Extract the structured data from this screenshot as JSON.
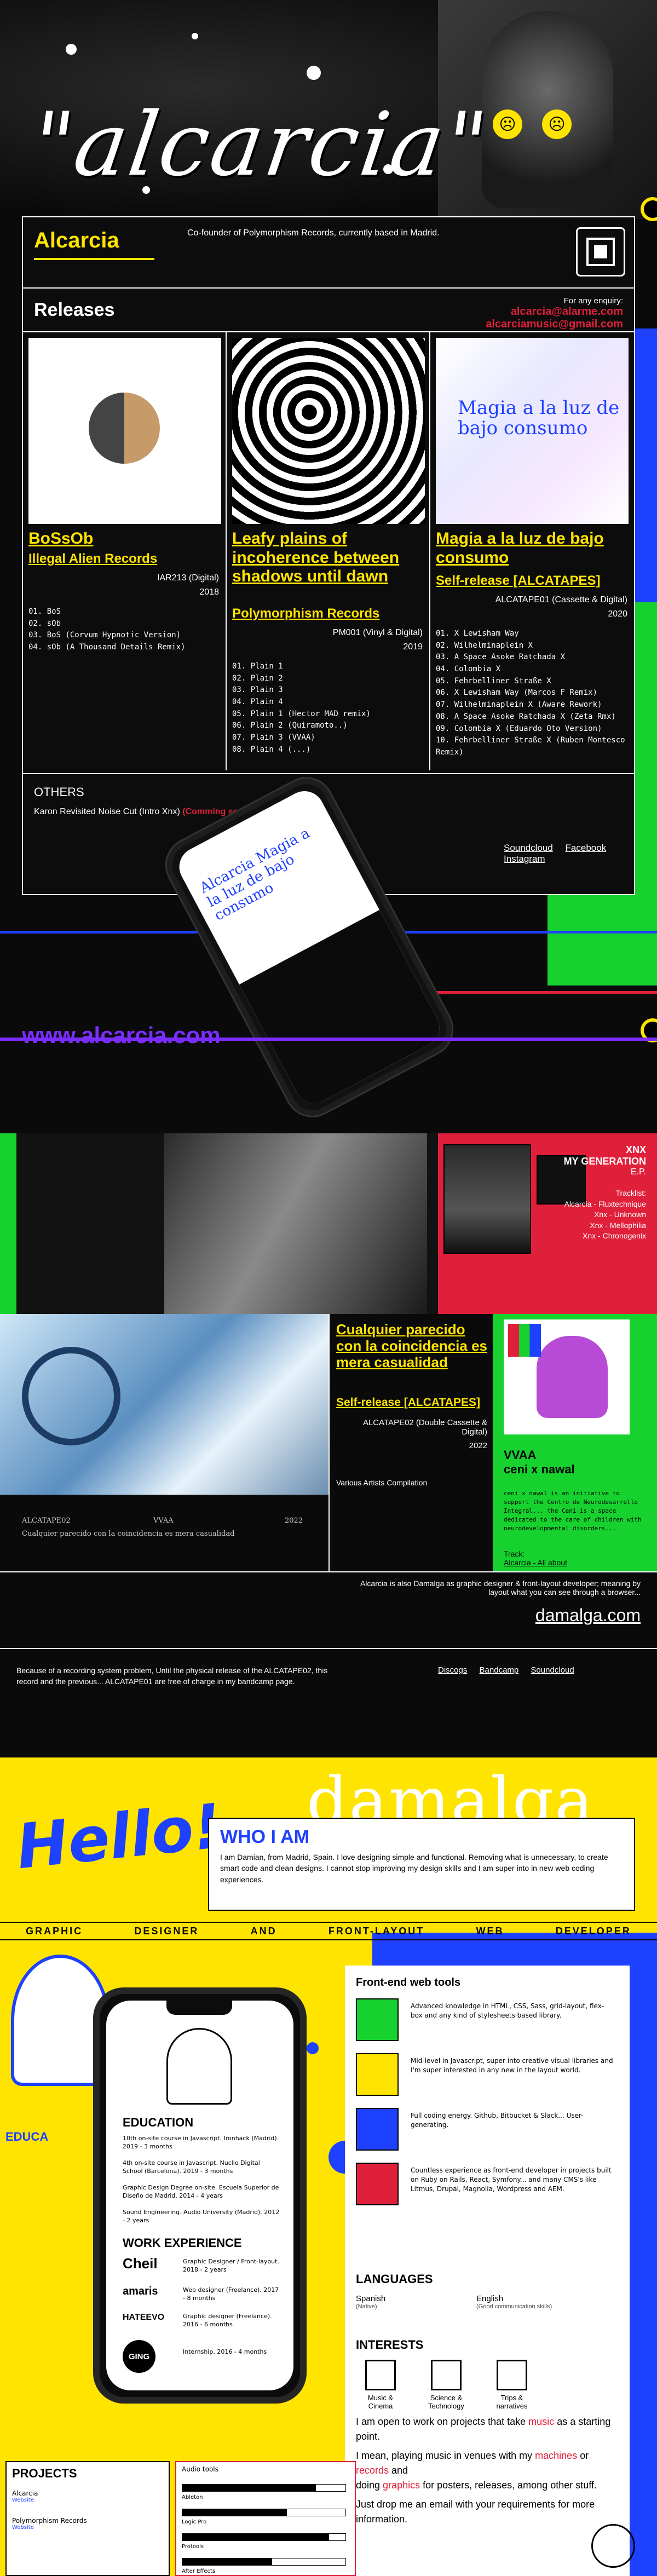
{
  "hero": {
    "logo": "\"alcarcia\"",
    "smiley_glyph": "☹"
  },
  "panel": {
    "brand": "Alcarcia",
    "intro": "Co-founder of Polymorphism Records, currently based in Madrid.",
    "releases_title": "Releases",
    "enquiry_label": "For any enquiry:",
    "enquiry_email_1": "alcarcia@alarme.com",
    "enquiry_email_2": "alcarciamusic@gmail.com",
    "releases": [
      {
        "title": "BoSsOb",
        "subtitle": "Illegal Alien Records",
        "catalog": "IAR213 (Digital)",
        "year": "2018",
        "tracks": [
          "01. BoS",
          "02. sOb",
          "03. BoS (Corvum Hypnotic Version)",
          "04. sOb (A Thousand Details Remix)"
        ]
      },
      {
        "title": "Leafy plains of incoherence between shadows until dawn",
        "subtitle": "Polymorphism Records",
        "catalog": "PM001 (Vinyl & Digital)",
        "year": "2019",
        "tracks": [
          "01. Plain 1",
          "02. Plain 2",
          "03. Plain 3",
          "04. Plain 4",
          "05. Plain 1 (Hector MAD remix)",
          "06. Plain 2 (Quiramoto..)",
          "07. Plain 3 (VVAA)",
          "08. Plain 4 (...)"
        ]
      },
      {
        "title": "Magia a la luz de bajo consumo",
        "subtitle": "Self-release [ALCATAPES]",
        "catalog": "ALCATAPE01 (Cassette & Digital)",
        "year": "2020",
        "tracks": [
          "01. X Lewisham Way",
          "02. Wilhelminaplein X",
          "03. A Space Asoke Ratchada X",
          "04. Colombia X",
          "05. Fehrbelliner Straße X",
          "06. X Lewisham Way (Marcos F Remix)",
          "07. Wilhelminaplein X (Aware Rework)",
          "08. A Space Asoke Ratchada X (Zeta Rmx)",
          "09. Colombia X (Eduardo Oto Version)",
          "10. Fehrbelliner Straße X (Ruben Montesco Remix)"
        ]
      }
    ],
    "others_title": "OTHERS",
    "others_item": "Karon Revisited Noise Cut (Intro Xnx)",
    "others_soon": "(Comming soon)",
    "social": [
      "Soundcloud",
      "Facebook",
      "Instagram"
    ]
  },
  "phone1": {
    "cover_title": "Alcarcia Magia a la luz de bajo consumo"
  },
  "url": "www.alcarcia.com",
  "collage": {
    "mygen_title": "XNX",
    "mygen_sub": "MY GENERATION",
    "mygen_ep": "E.P.",
    "mygen_tracklist": "Tracklist:",
    "mygen_tracks": [
      "Alcarcia - Fluxtechnique",
      "Xnx - Unknown",
      "Xnx - Mellophilia",
      "Xnx - Chronogenix"
    ],
    "cual_title": "Cualquier parecido con la coincidencia es mera casualidad",
    "cual_label": "Self-release [ALCATAPES]",
    "cual_catalog": "ALCATAPE02 (Double Cassette & Digital)",
    "cual_year": "2022",
    "cual_comp": "Various Artists Compilation",
    "cual_cover_caption": "Cualquier parecido con la coincidencia es mera casualidad",
    "cual_cover_small_1": "ALCATAPE02",
    "cual_cover_small_2": "VVAA",
    "cual_cover_small_3": "2022",
    "ceni_title": "VVAA",
    "ceni_sub": "ceni x nawal",
    "ceni_desc": "ceni x nawal is an initiative to support the Centro de Neurodesarrollo Integral... the Ceni is a space dedicated to the care of children with neurodevelopmental disorders...",
    "ceni_track_label": "Track:",
    "ceni_track": "Alcarcia - All about",
    "damalga_note": "Alcarcia is also Damalga as graphic designer & front-layout developer; meaning by layout what you can see through a browser...",
    "damalga_link": "damalga.com"
  },
  "note": {
    "text": "Because of a recording system problem, Until the physical release of the ALCATAPE02, this record and the previous... ALCATAPE01 are free of charge in my bandcamp page.",
    "links": [
      "Discogs",
      "Bandcamp",
      "Soundcloud"
    ]
  },
  "damalga": {
    "word": "damalga",
    "hello": "Hello!",
    "whoami": "WHO I AM",
    "whoami_text": "I am Damian, from Madrid, Spain. I love designing simple and functional. Removing what is unnecessary, to create smart code and clean designs. I cannot stop improving my design skills and I am super into in new web coding experiences.",
    "roles": [
      "GRAPHIC",
      "DESIGNER",
      "AND",
      "FRONT-LAYOUT",
      "WEB",
      "DEVELOPER"
    ],
    "education_tag": "EDUCA",
    "phone": {
      "education": "EDUCATION",
      "edu_items": [
        "10th on-site course in Javascript. Ironhack (Madrid). 2019 - 3 months",
        "4th on-site course in Javascript. Nuclio Digital School (Barcelona). 2019 - 3 months",
        "Graphic Design Degree on-site. Escuela Superior de Diseño de Madrid. 2014 - 4 years",
        "Sound Engineering. Audio University (Madrid). 2012 - 2 years"
      ],
      "work": "WORK EXPERIENCE",
      "work_items": [
        {
          "company": "Cheil",
          "role": "Graphic Designer / Front-layout. 2018 - 2 years"
        },
        {
          "company": "amaris",
          "role": "Web designer (Freelance). 2017 - 8 months"
        },
        {
          "company": "HATEEVO",
          "role": "Graphic designer (Freelance). 2016 - 6 months"
        },
        {
          "company": "GING",
          "role": "Internship. 2016 - 4 months"
        }
      ]
    },
    "frontend_title": "Front-end web tools",
    "skills": [
      "Advanced knowledge in HTML, CSS, Sass, grid-layout, flex-box and any kind of stylesheets based library.",
      "Mid-level in Javascript, super into creative visual libraries and I'm super interested in any new in the layout world.",
      "Full coding energy. Github, Bitbucket & Slack... User-generating.",
      "Countless experience as front-end developer in projects built on Ruby on Rails, React, Symfony... and many CMS's like Litmus, Drupal, Magnolia, Wordpress and AEM."
    ],
    "languages_title": "LANGUAGES",
    "languages": [
      {
        "name": "Spanish",
        "level": "(Native)"
      },
      {
        "name": "English",
        "level": "(Good communication skills)"
      }
    ],
    "interests_title": "INTERESTS",
    "interests": [
      "Music & Cinema",
      "Science & Technology",
      "Trips & narratives"
    ],
    "music_1": "I am open to work on projects that take ",
    "music_1_hl": "music",
    "music_1_end": " as a starting point.",
    "music_2": "I mean, playing music in venues with my ",
    "music_2_hl1": "machines",
    "music_2_mid": " or ",
    "music_2_hl2": "records",
    "music_2_end": " and",
    "music_3": "doing ",
    "music_3_hl": "graphics",
    "music_3_end": " for posters, releases, among other stuff.",
    "music_4": "Just drop me an email with your requirements for more information.",
    "projects_title": "PROJECTS",
    "projects": [
      {
        "name": "Alcarcia",
        "link": "Website"
      },
      {
        "name": "Polymorphism Records",
        "link": "Website"
      }
    ],
    "audio_title": "Audio tools",
    "audio_levels": [
      0.82,
      0.64,
      0.9,
      0.55
    ],
    "audio_tools": [
      "Ableton",
      "Logic Pro",
      "Protools",
      "After Effects"
    ]
  },
  "colors": {
    "yellow": "#ffe400",
    "red": "#e0203a",
    "blue": "#1e40ff",
    "green": "#16d12e",
    "violet": "#7b2cff"
  }
}
